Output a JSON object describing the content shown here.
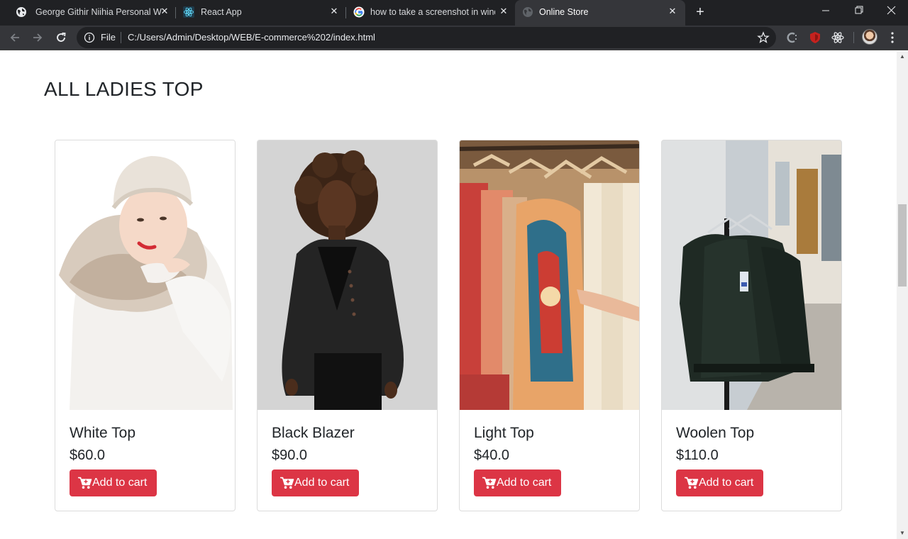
{
  "browser": {
    "tabs": [
      {
        "title": "George Githir Niihia Personal We",
        "icon": "globe-icon",
        "active": false
      },
      {
        "title": "React App",
        "icon": "react-icon",
        "active": false
      },
      {
        "title": "how to take a screenshot in wind",
        "icon": "google-icon",
        "active": false
      },
      {
        "title": "Online Store",
        "icon": "globe-icon",
        "active": true
      }
    ],
    "new_tab_label": "+",
    "window_controls": {
      "minimize": "–",
      "restore": "❐",
      "close": "✕"
    },
    "address_bar": {
      "scheme_label": "File",
      "url": "C:/Users/Admin/Desktop/WEB/E-commerce%202/index.html"
    },
    "extensions": [
      "chatgpt-extension-icon",
      "shield-extension-icon",
      "react-devtools-icon"
    ]
  },
  "page": {
    "heading": "ALL LADIES TOP",
    "button_color": "#dc3545",
    "products": [
      {
        "name": "White Top",
        "price": "$60.0",
        "button_label": "Add to cart"
      },
      {
        "name": "Black Blazer",
        "price": "$90.0",
        "button_label": "Add to cart"
      },
      {
        "name": "Light Top",
        "price": "$40.0",
        "button_label": "Add to cart"
      },
      {
        "name": "Woolen Top",
        "price": "$110.0",
        "button_label": "Add to cart"
      }
    ]
  }
}
